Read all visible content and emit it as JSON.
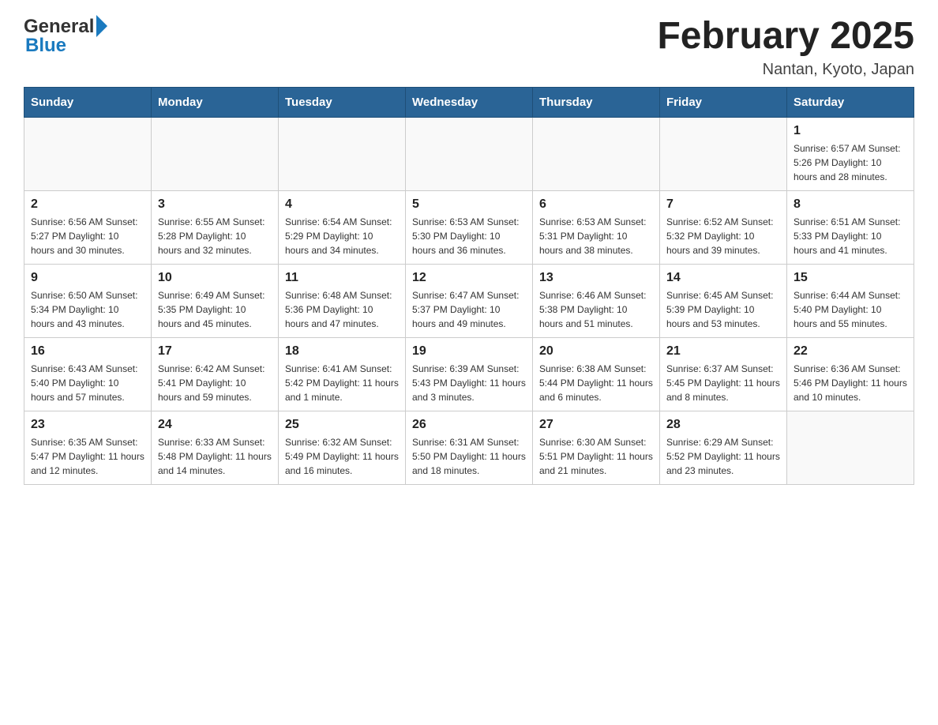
{
  "header": {
    "logo_general": "General",
    "logo_blue": "Blue",
    "month_title": "February 2025",
    "location": "Nantan, Kyoto, Japan"
  },
  "calendar": {
    "days_of_week": [
      "Sunday",
      "Monday",
      "Tuesday",
      "Wednesday",
      "Thursday",
      "Friday",
      "Saturday"
    ],
    "weeks": [
      [
        {
          "day": "",
          "info": ""
        },
        {
          "day": "",
          "info": ""
        },
        {
          "day": "",
          "info": ""
        },
        {
          "day": "",
          "info": ""
        },
        {
          "day": "",
          "info": ""
        },
        {
          "day": "",
          "info": ""
        },
        {
          "day": "1",
          "info": "Sunrise: 6:57 AM\nSunset: 5:26 PM\nDaylight: 10 hours and 28 minutes."
        }
      ],
      [
        {
          "day": "2",
          "info": "Sunrise: 6:56 AM\nSunset: 5:27 PM\nDaylight: 10 hours and 30 minutes."
        },
        {
          "day": "3",
          "info": "Sunrise: 6:55 AM\nSunset: 5:28 PM\nDaylight: 10 hours and 32 minutes."
        },
        {
          "day": "4",
          "info": "Sunrise: 6:54 AM\nSunset: 5:29 PM\nDaylight: 10 hours and 34 minutes."
        },
        {
          "day": "5",
          "info": "Sunrise: 6:53 AM\nSunset: 5:30 PM\nDaylight: 10 hours and 36 minutes."
        },
        {
          "day": "6",
          "info": "Sunrise: 6:53 AM\nSunset: 5:31 PM\nDaylight: 10 hours and 38 minutes."
        },
        {
          "day": "7",
          "info": "Sunrise: 6:52 AM\nSunset: 5:32 PM\nDaylight: 10 hours and 39 minutes."
        },
        {
          "day": "8",
          "info": "Sunrise: 6:51 AM\nSunset: 5:33 PM\nDaylight: 10 hours and 41 minutes."
        }
      ],
      [
        {
          "day": "9",
          "info": "Sunrise: 6:50 AM\nSunset: 5:34 PM\nDaylight: 10 hours and 43 minutes."
        },
        {
          "day": "10",
          "info": "Sunrise: 6:49 AM\nSunset: 5:35 PM\nDaylight: 10 hours and 45 minutes."
        },
        {
          "day": "11",
          "info": "Sunrise: 6:48 AM\nSunset: 5:36 PM\nDaylight: 10 hours and 47 minutes."
        },
        {
          "day": "12",
          "info": "Sunrise: 6:47 AM\nSunset: 5:37 PM\nDaylight: 10 hours and 49 minutes."
        },
        {
          "day": "13",
          "info": "Sunrise: 6:46 AM\nSunset: 5:38 PM\nDaylight: 10 hours and 51 minutes."
        },
        {
          "day": "14",
          "info": "Sunrise: 6:45 AM\nSunset: 5:39 PM\nDaylight: 10 hours and 53 minutes."
        },
        {
          "day": "15",
          "info": "Sunrise: 6:44 AM\nSunset: 5:40 PM\nDaylight: 10 hours and 55 minutes."
        }
      ],
      [
        {
          "day": "16",
          "info": "Sunrise: 6:43 AM\nSunset: 5:40 PM\nDaylight: 10 hours and 57 minutes."
        },
        {
          "day": "17",
          "info": "Sunrise: 6:42 AM\nSunset: 5:41 PM\nDaylight: 10 hours and 59 minutes."
        },
        {
          "day": "18",
          "info": "Sunrise: 6:41 AM\nSunset: 5:42 PM\nDaylight: 11 hours and 1 minute."
        },
        {
          "day": "19",
          "info": "Sunrise: 6:39 AM\nSunset: 5:43 PM\nDaylight: 11 hours and 3 minutes."
        },
        {
          "day": "20",
          "info": "Sunrise: 6:38 AM\nSunset: 5:44 PM\nDaylight: 11 hours and 6 minutes."
        },
        {
          "day": "21",
          "info": "Sunrise: 6:37 AM\nSunset: 5:45 PM\nDaylight: 11 hours and 8 minutes."
        },
        {
          "day": "22",
          "info": "Sunrise: 6:36 AM\nSunset: 5:46 PM\nDaylight: 11 hours and 10 minutes."
        }
      ],
      [
        {
          "day": "23",
          "info": "Sunrise: 6:35 AM\nSunset: 5:47 PM\nDaylight: 11 hours and 12 minutes."
        },
        {
          "day": "24",
          "info": "Sunrise: 6:33 AM\nSunset: 5:48 PM\nDaylight: 11 hours and 14 minutes."
        },
        {
          "day": "25",
          "info": "Sunrise: 6:32 AM\nSunset: 5:49 PM\nDaylight: 11 hours and 16 minutes."
        },
        {
          "day": "26",
          "info": "Sunrise: 6:31 AM\nSunset: 5:50 PM\nDaylight: 11 hours and 18 minutes."
        },
        {
          "day": "27",
          "info": "Sunrise: 6:30 AM\nSunset: 5:51 PM\nDaylight: 11 hours and 21 minutes."
        },
        {
          "day": "28",
          "info": "Sunrise: 6:29 AM\nSunset: 5:52 PM\nDaylight: 11 hours and 23 minutes."
        },
        {
          "day": "",
          "info": ""
        }
      ]
    ]
  }
}
